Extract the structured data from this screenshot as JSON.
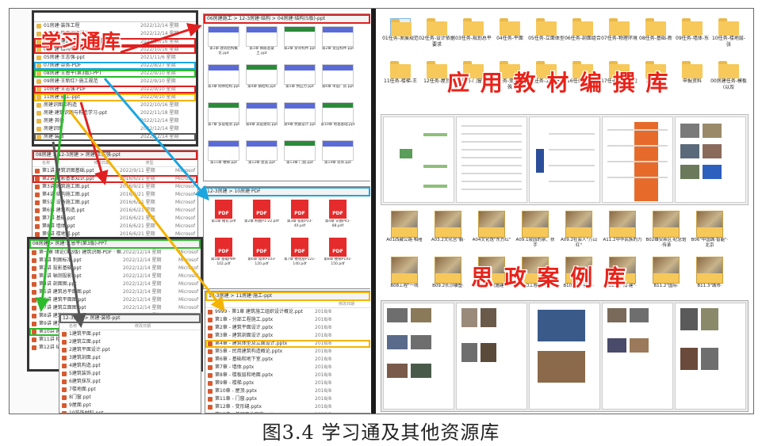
{
  "labels": {
    "xuexitong": "学习通库",
    "textbook": "应 用 教 材 编 撰 库",
    "sizheng": "思 政 案 例 库"
  },
  "caption": "图3.4 学习通及其他资源库",
  "colors": {
    "red": "#e02020",
    "blue": "#1ca6e0",
    "orange": "#f4b400",
    "gray": "#555555",
    "green": "#2cbb2c",
    "folder": "#f7c95a"
  },
  "left": {
    "explorer_rows": [
      {
        "name": "01房建·装饰工程",
        "date": "2022/12/14 星期",
        "type": "",
        "icon": "folder",
        "hl": ""
      },
      {
        "name": "02房建·施工组织设计",
        "date": "2022/12/14 星期",
        "type": "",
        "icon": "folder",
        "hl": ""
      },
      {
        "name": "03房建·建筑构造(第3版)-ppt",
        "date": "2022/10/16 星期",
        "type": "",
        "icon": "folder",
        "hl": "red"
      },
      {
        "name": "04房建·结构(第5版)-ppt",
        "date": "2022/10/16 星期",
        "type": "",
        "icon": "folder",
        "hl": "red"
      },
      {
        "name": "05房建·王志强-ppt",
        "date": "2021/11/6 星期",
        "type": "",
        "icon": "folder",
        "hl": ""
      },
      {
        "name": "07房建·杂务-PDF",
        "date": "2022/8/27 星期",
        "type": "",
        "icon": "folder",
        "hl": "blue"
      },
      {
        "name": "08房建·王恩平(第3版)-PPT",
        "date": "2022/9/10 星期",
        "type": "",
        "icon": "folder",
        "hl": "green"
      },
      {
        "name": "09房建·王新红?·施工规范",
        "date": "2022/9/10 星期",
        "type": "",
        "icon": "folder",
        "hl": ""
      },
      {
        "name": "10房建·王志强-PDF",
        "date": "2022/9/10 星期",
        "type": "",
        "icon": "folder",
        "hl": "red"
      },
      {
        "name": "11房建·施工-ppt",
        "date": "2022/9/10 星期",
        "type": "",
        "icon": "folder",
        "hl": "orange"
      },
      {
        "name": "房建识图和构造",
        "date": "2022/10/16 星期",
        "type": "",
        "icon": "folder",
        "hl": ""
      },
      {
        "name": "房建·建筑识图与构造学习-ppt",
        "date": "2022/11/18 星期",
        "type": "",
        "icon": "folder",
        "hl": ""
      },
      {
        "name": "房建·其他",
        "date": "2022/12/14 星期",
        "type": "",
        "icon": "folder",
        "hl": ""
      },
      {
        "name": "房建识图",
        "date": "2022/12/14 星期",
        "type": "",
        "icon": "folder",
        "hl": ""
      },
      {
        "name": "房建·装修",
        "date": "2022/12/14 星期",
        "type": "",
        "icon": "folder",
        "hl": "gray"
      }
    ],
    "top_ppt_window": {
      "address": "06房建施工 > 12-3房建·结构 > 04房建·结构(5版)-ppt",
      "items": [
        "第1章 建筑结构概论.ppt",
        "第1章 钢筋混凝土.ppt",
        "第2章 受弯构件.ppt",
        "第2章 受压构件.ppt",
        "第3章 砌体结构.ppt",
        "第4章 钢结构.ppt",
        "第5章 预应力.ppt",
        "第6章 单层厂房.ppt",
        "第7章 多层框架.ppt",
        "第8章 高层建筑.ppt",
        "第9章 抗震设计.ppt",
        "第10章 地基基础.ppt",
        "第11章 楼梯.ppt",
        "第12章 屋盖.ppt",
        "第13章 门窗.ppt",
        "第14章 装饰.ppt"
      ]
    },
    "middle_window": {
      "address": "08房建 > 12-3房建 > 房建·王志强-ppt",
      "rows": [
        {
          "name": "第1讲 建筑识图基础.ppt",
          "date": "2022/9/11 星期",
          "type": "Microsof",
          "hl": ""
        },
        {
          "name": "第2讲 投影基本知识.ppt",
          "date": "2016/6/21 星期",
          "type": "Microsof",
          "hl": "red"
        },
        {
          "name": "第3讲 建筑施工图.ppt",
          "date": "2016/9/21 星期",
          "type": "Microsof",
          "hl": ""
        },
        {
          "name": "第4讲 结构施工图.ppt",
          "date": "2016/6/21 星期",
          "type": "Microsof",
          "hl": ""
        },
        {
          "name": "第5讲 设备施工图.ppt",
          "date": "2016/6/21 星期",
          "type": "Microsof",
          "hl": ""
        },
        {
          "name": "第6讲 建筑构造.ppt",
          "date": "2016/6/21 星期",
          "type": "Microsof",
          "hl": ""
        },
        {
          "name": "第7讲 基础.ppt",
          "date": "2016/6/21 星期",
          "type": "Microsof",
          "hl": ""
        },
        {
          "name": "第8讲 墙体.ppt",
          "date": "2016/6/21 星期",
          "type": "Microsof",
          "hl": ""
        },
        {
          "name": "第9讲 楼地层.ppt",
          "date": "2016/6/21 星期",
          "type": "Microsof",
          "hl": ""
        }
      ]
    },
    "pdf_window": {
      "address": "12-3房建 > 10房建·PDF",
      "items": [
        "第1章 绪论.pdf",
        "第2章 制图P1-22.pdf",
        "第3章 投影P23-40.pdf",
        "第4章 识图P41-88.pdf",
        "第5章 基础P89-102.pdf",
        "第6章 墙体P103-120.pdf",
        "第7章 楼地层P121-140.pdf",
        "第8章 楼梯P141-150.pdf"
      ]
    },
    "lower_window": {
      "address": "08房建 > 房建·王恩平(第3版)-PPT",
      "rows": [
        {
          "name": "第一章 绪论(第3版) 建筑识图-PDF · 框...",
          "date": "2022/12/14 星期",
          "type": "Microsof",
          "hl": ""
        },
        {
          "name": "第1讲 制图标准.ppt",
          "date": "2022/12/14 星期",
          "type": "Microsof",
          "hl": ""
        },
        {
          "name": "第2讲 投影基础.ppt",
          "date": "2022/12/14 星期",
          "type": "Microsof",
          "hl": ""
        },
        {
          "name": "第3讲 轴测投影.ppt",
          "date": "2022/12/14 星期",
          "type": "Microsof",
          "hl": ""
        },
        {
          "name": "第4讲 剖面图.ppt",
          "date": "2022/12/14 星期",
          "type": "Microsof",
          "hl": ""
        },
        {
          "name": "第5讲 建筑总平面图.ppt",
          "date": "2022/12/14 星期",
          "type": "Microsof",
          "hl": ""
        },
        {
          "name": "第6讲 建筑平面图.ppt",
          "date": "2022/12/14 星期",
          "type": "Microsof",
          "hl": ""
        },
        {
          "name": "第7讲 建筑立面图.ppt",
          "date": "2022/12/14 星期",
          "type": "Microsof",
          "hl": ""
        },
        {
          "name": "第8讲 建筑剖面图.ppt",
          "date": "2022/12/14 星期",
          "type": "Microsof",
          "hl": ""
        },
        {
          "name": "第9讲 建筑详图.ppt",
          "date": "2022/12/14 星期",
          "type": "Microsof",
          "hl": ""
        },
        {
          "name": "第10讲 建筑(二版)识图-第8章",
          "date": "2022/12/14 星期",
          "type": "Microsof",
          "hl": "green"
        },
        {
          "name": "第11讲 楼梯详图.ppt",
          "date": "2022/12/14 星期",
          "type": "Microsof",
          "hl": ""
        },
        {
          "name": "第12讲 结构施工图.ppt",
          "date": "2022/12/14 星期",
          "type": "Microsof",
          "hl": ""
        }
      ]
    },
    "bottom_gray_window": {
      "address": "12-3房建 > 房建·装修-ppt",
      "rows": [
        "1建筑平面.ppt",
        "2建筑立面.ppt",
        "2建筑平面设计.ppt",
        "3建筑剖面.ppt",
        "4建筑构造.ppt",
        "5建筑装饰.ppt",
        "6建筑抹灰.ppt",
        "7楼地面.ppt",
        "8门窗.ppt",
        "9屋面.ppt",
        "10装饰材料.ppt"
      ]
    },
    "bottom_orange_window": {
      "address": "12-3房建 > 11房建·施工-ppt",
      "rows": [
        {
          "name": "9999 - 第1章 建筑施工组织设计概论.ppt",
          "date": "2018/8",
          "hl": ""
        },
        {
          "name": "第1章 - 分部工程施工.pptx",
          "date": "2018/8",
          "hl": ""
        },
        {
          "name": "第2章 - 建筑平面设计.pptx",
          "date": "2018/8",
          "hl": ""
        },
        {
          "name": "第3章 - 建筑剖面设计.pptx",
          "date": "2018/8",
          "hl": ""
        },
        {
          "name": "第4章 - 建筑体型及立面设计.pptx",
          "date": "2018/8",
          "hl": "orange"
        },
        {
          "name": "第5章 - 民用建筑构造概论.pptx",
          "date": "2018/8",
          "hl": ""
        },
        {
          "name": "第6章 - 基础和地下室.pptx",
          "date": "2018/8",
          "hl": ""
        },
        {
          "name": "第7章 - 墙体.pptx",
          "date": "2018/8",
          "hl": ""
        },
        {
          "name": "第8章 - 楼板层和地面.pptx",
          "date": "2018/8",
          "hl": ""
        },
        {
          "name": "第9章 - 楼梯.pptx",
          "date": "2018/8",
          "hl": ""
        },
        {
          "name": "第10章 - 屋顶.pptx",
          "date": "2018/8",
          "hl": ""
        },
        {
          "name": "第11章 - 门窗.pptx",
          "date": "2018/8",
          "hl": ""
        },
        {
          "name": "第12章 - 变形缝.pptx",
          "date": "2018/8",
          "hl": ""
        },
        {
          "name": "第13章 - 单层工业厂房.pptx",
          "date": "2018/8",
          "hl": ""
        },
        {
          "name": "第14章 - 建筑工业化.pptx",
          "date": "2018/8",
          "hl": ""
        }
      ]
    }
  },
  "right": {
    "textbook_folders": [
      "01任务-发展规范",
      "02任务-设计依据要求",
      "03任务-规划总平",
      "04任务-平面",
      "05任务-立面体型",
      "06任务-剖面组合",
      "07任务-物理环境",
      "08任务-基础-新",
      "09任务-墙体-东",
      "10任务-楼地层-张",
      "11任务-楼梯-王",
      "12任务-屋顶",
      "13任务-门窗进阳",
      "14任务-变形缝特殊",
      "15任务-工业建筑",
      "16任务-装配式",
      "17任务-智能建造",
      "其他图片",
      "申报资料",
      "00房建任务-模板(以及"
    ],
    "case_folders": [
      "A01西藏公路·帕隆",
      "A03.2文化宫\"鹏·",
      "A04文化馆\"东方红\"",
      "A09.1陵园的泉、扶手",
      "A09.2社会人\"万山红\"",
      "A11.2中华民族的力",
      "B02雄安新区·纪念馆·传承",
      "B06\"中国城·智能\"·北京",
      "B08工程\"一线",
      "B09.2长沙雕塑·",
      "B09\"家庭施建\"·",
      "B10工程\"团建·",
      "B10.1\"建学家\"·",
      "B11.1\"湘·建\"·",
      "B11.2\"国际·",
      "B11.3\"城市·",
      "B11.3家人\"亲\""
    ]
  }
}
